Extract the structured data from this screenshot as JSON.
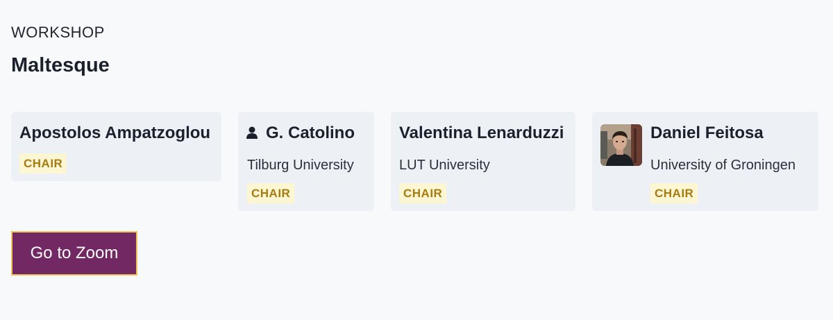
{
  "session": {
    "kind": "WORKSHOP",
    "title": "Maltesque"
  },
  "people": [
    {
      "name": "Apostolos Ampatzoglou",
      "affiliation": "",
      "role": "CHAIR",
      "icon": "none"
    },
    {
      "name": "G. Catolino",
      "affiliation": "Tilburg University",
      "role": "CHAIR",
      "icon": "person-icon"
    },
    {
      "name": "Valentina Lenarduzzi",
      "affiliation": "LUT University",
      "role": "CHAIR",
      "icon": "none"
    },
    {
      "name": "Daniel Feitosa",
      "affiliation": "University of Groningen",
      "role": "CHAIR",
      "icon": "avatar-photo"
    }
  ],
  "actions": {
    "zoom_label": "Go to Zoom"
  },
  "colors": {
    "background": "#f8f9fb",
    "card": "#edf1f5",
    "badge_bg": "#fdf6d3",
    "badge_text": "#a77a12",
    "button": "#722863",
    "button_border": "#f0c35a"
  }
}
